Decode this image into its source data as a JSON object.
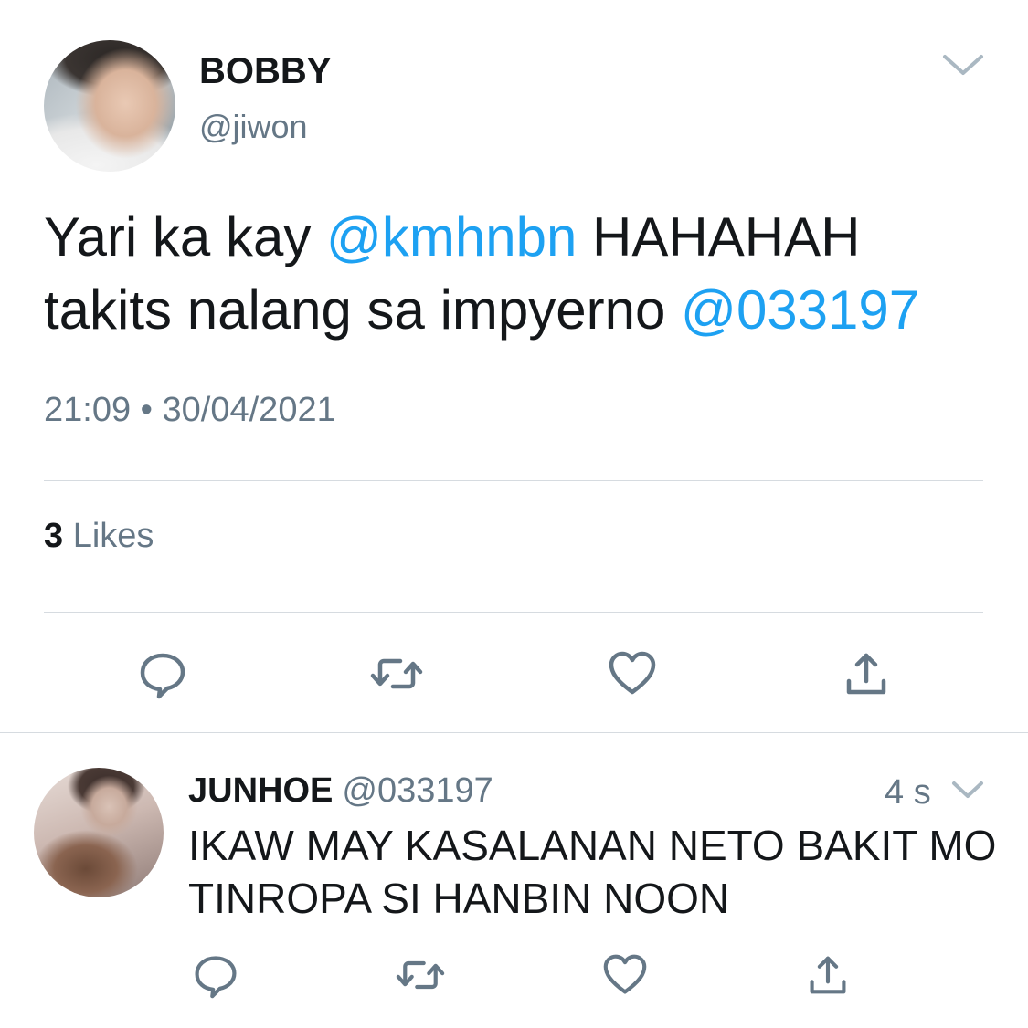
{
  "tweet": {
    "author_name": "BOBBY",
    "author_handle": "@jiwon",
    "text_parts": [
      {
        "text": "Yari ka kay ",
        "type": "plain"
      },
      {
        "text": "@kmhnbn",
        "type": "mention"
      },
      {
        "text": " HAHAHAH takits nalang sa impyerno ",
        "type": "plain"
      },
      {
        "text": "@033197",
        "type": "mention"
      }
    ],
    "time": "21:09",
    "separator": "•",
    "date": "30/04/2021",
    "likes_count": "3",
    "likes_label": "Likes",
    "actions": [
      "reply-icon",
      "retweet-icon",
      "like-icon",
      "share-icon"
    ]
  },
  "reply": {
    "author_name": "JUNHOE",
    "author_handle": "@033197",
    "relative_time": "4 s",
    "text": "IKAW MAY KASALANAN NETO BAKIT MO TINROPA SI HANBIN NOON",
    "actions": [
      "reply-icon",
      "retweet-icon",
      "like-icon",
      "share-icon"
    ]
  },
  "colors": {
    "mention": "#1da1f2",
    "secondary_text": "#657786",
    "icon": "#657786",
    "divider": "#d6dbe0"
  }
}
